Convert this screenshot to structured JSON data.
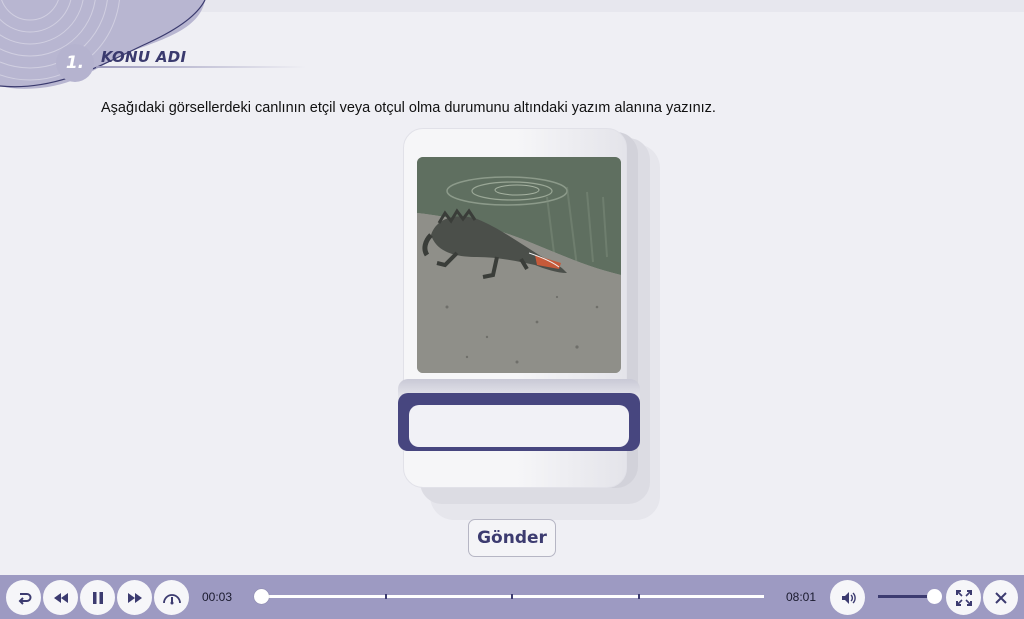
{
  "topic": {
    "number": "1.",
    "title": "KONU ADI"
  },
  "instruction": "Aşağıdaki görsellerdeki canlının etçil veya otçul olma durumunu altındaki yazım alanına yazınız.",
  "card": {
    "image_subject": "crocodile",
    "answer_value": "",
    "answer_placeholder": ""
  },
  "submit_label": "Gönder",
  "player": {
    "current_time": "00:03",
    "total_time": "08:01",
    "progress_fraction": 0.006,
    "chapter_ticks_fraction": [
      0.25,
      0.5,
      0.75
    ],
    "volume_fraction": 1.0,
    "icons": [
      "replay-icon",
      "rewind-icon",
      "pause-icon",
      "fast-forward-icon",
      "speed-icon",
      "volume-icon",
      "fullscreen-icon",
      "close-icon"
    ]
  },
  "colors": {
    "accent": "#47467f",
    "control_bar": "#9d9ac2",
    "background": "#efeff4",
    "title": "#3a3a6e"
  }
}
